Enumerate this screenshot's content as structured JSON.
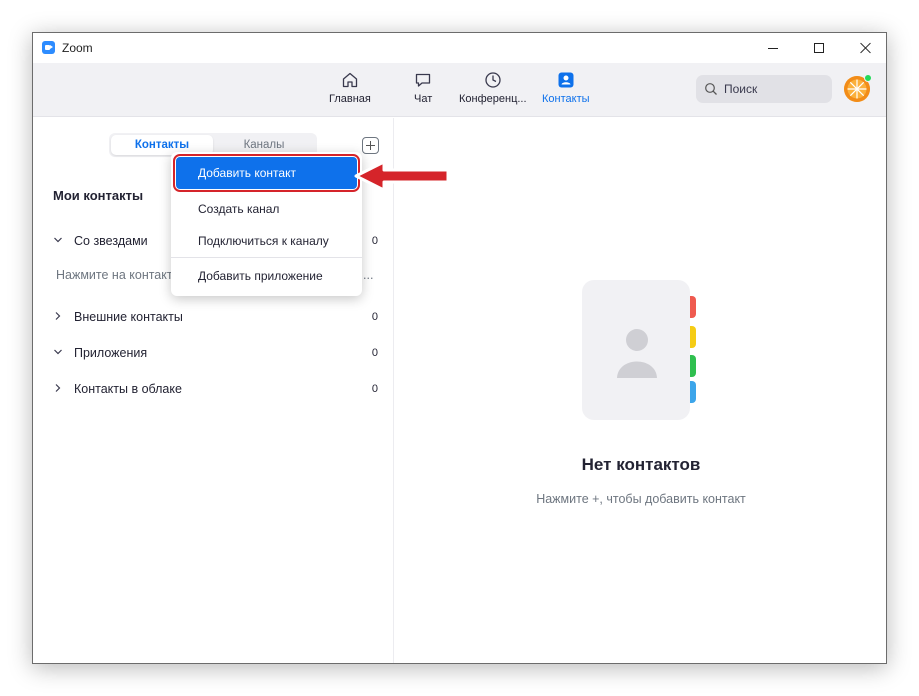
{
  "window": {
    "title": "Zoom"
  },
  "nav": {
    "tabs": [
      {
        "label": "Главная",
        "icon": "home-icon",
        "active": false
      },
      {
        "label": "Чат",
        "icon": "chat-icon",
        "active": false
      },
      {
        "label": "Конференц...",
        "icon": "clock-icon",
        "active": false
      },
      {
        "label": "Контакты",
        "icon": "contacts-icon",
        "active": true
      }
    ],
    "search_placeholder": "Поиск"
  },
  "contacts_panel": {
    "tabs": [
      "Контакты",
      "Каналы"
    ],
    "section_title": "Мои контакты",
    "groups": [
      {
        "label": "Со звездами",
        "count": "0",
        "expanded": true
      },
      {
        "label": "Внешние контакты",
        "count": "0",
        "expanded": false
      },
      {
        "label": "Приложения",
        "count": "0",
        "expanded": true
      },
      {
        "label": "Контакты в облаке",
        "count": "0",
        "expanded": false
      }
    ],
    "starred_hint": "Нажмите на контакт",
    "starred_hint_ellipsis": "..."
  },
  "dropdown_menu": {
    "items": [
      "Добавить контакт",
      "Создать канал",
      "Подключиться к каналу",
      "Добавить приложение"
    ],
    "highlighted_index": 0
  },
  "empty_state": {
    "title": "Нет контактов",
    "subtitle": "Нажмите +, чтобы добавить контакт"
  },
  "colors": {
    "accent": "#0e71eb",
    "annotation_red": "#d5242a",
    "tab_red": "#ef5a4f",
    "tab_yellow": "#f5cc15",
    "tab_green": "#2fbf4f",
    "tab_blue": "#3ca5ea",
    "presence": "#23d959"
  }
}
